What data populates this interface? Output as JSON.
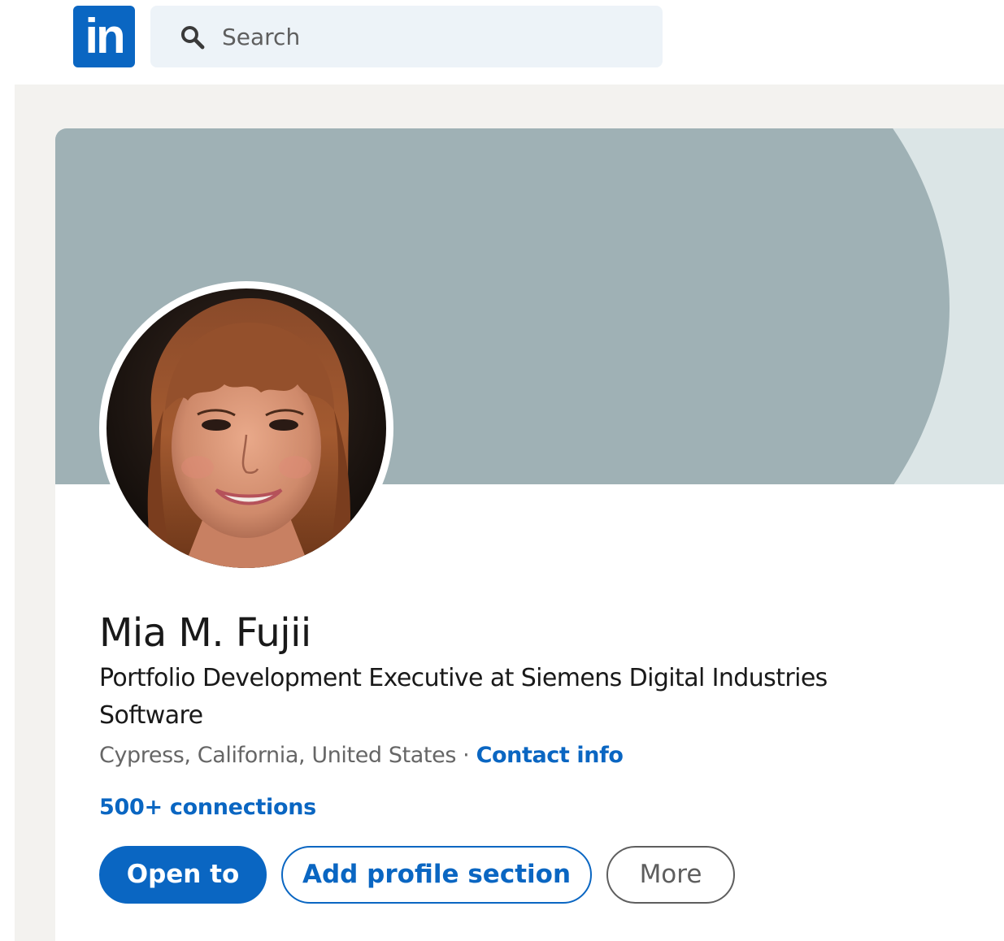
{
  "header": {
    "logo_text": "in",
    "logo_icon": "linkedin-logo",
    "search": {
      "placeholder": "Search",
      "icon": "search-icon"
    }
  },
  "profile": {
    "banner_colors": {
      "background": "#dbe5e6",
      "shape": "#9fb1b5"
    },
    "avatar": "profile-photo",
    "name": "Mia M. Fujii",
    "headline": "Portfolio Development Executive at Siemens Digital Industries Software",
    "location": "Cypress, California, United States",
    "separator": " · ",
    "contact_info_label": "Contact info",
    "connections_label": "500+ connections",
    "actions": {
      "open_to_label": "Open to",
      "add_section_label": "Add profile section",
      "more_label": "More"
    }
  },
  "colors": {
    "brand": "#0a66c2",
    "page_background": "#f3f2ef",
    "search_background": "#edf3f8",
    "text_primary": "#191919",
    "text_secondary": "#666666"
  }
}
